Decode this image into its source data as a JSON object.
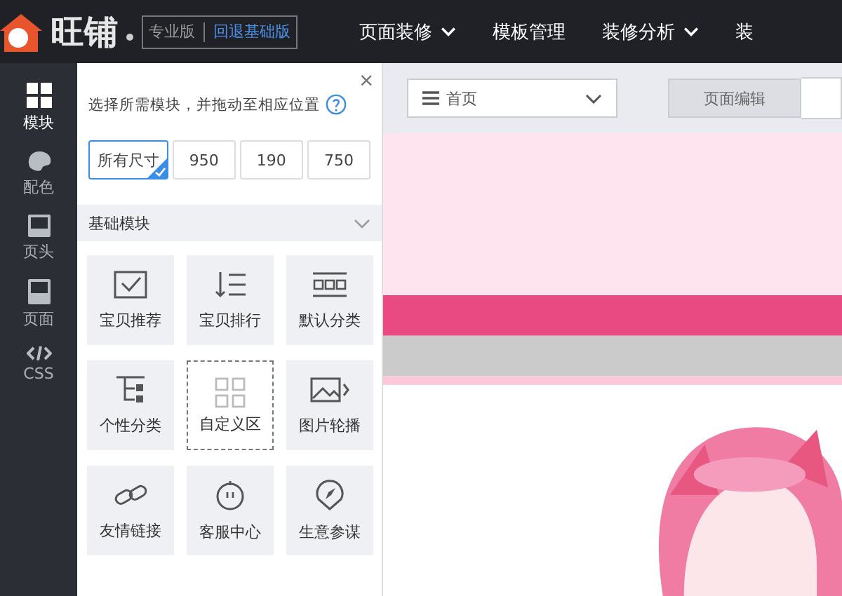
{
  "header": {
    "logo_text": "旺铺",
    "edition": "专业版",
    "downgrade_link": "回退基础版",
    "nav": [
      {
        "label": "页面装修",
        "dropdown": true
      },
      {
        "label": "模板管理",
        "dropdown": false
      },
      {
        "label": "装修分析",
        "dropdown": true
      },
      {
        "label": "装",
        "dropdown": false
      }
    ]
  },
  "rail": [
    {
      "label": "模块",
      "selected": true
    },
    {
      "label": "配色",
      "selected": false
    },
    {
      "label": "页头",
      "selected": false
    },
    {
      "label": "页面",
      "selected": false
    },
    {
      "label": "CSS",
      "selected": false
    }
  ],
  "panel": {
    "close": "×",
    "hint": "选择所需模块，并拖动至相应位置",
    "sizes": [
      {
        "label": "所有尺寸",
        "selected": true
      },
      {
        "label": "950",
        "selected": false
      },
      {
        "label": "190",
        "selected": false
      },
      {
        "label": "750",
        "selected": false
      }
    ],
    "section": {
      "title": "基础模块",
      "expanded": true
    },
    "modules": [
      {
        "label": "宝贝推荐",
        "dragging": false
      },
      {
        "label": "宝贝排行",
        "dragging": false
      },
      {
        "label": "默认分类",
        "dragging": false
      },
      {
        "label": "个性分类",
        "dragging": false
      },
      {
        "label": "自定义区",
        "dragging": true
      },
      {
        "label": "图片轮播",
        "dragging": false
      },
      {
        "label": "友情链接",
        "dragging": false
      },
      {
        "label": "客服中心",
        "dragging": false
      },
      {
        "label": "生意参谋",
        "dragging": false
      }
    ]
  },
  "canvas": {
    "page_select": {
      "value": "首页"
    },
    "tabs": [
      {
        "label": "页面编辑",
        "selected": true
      }
    ]
  }
}
